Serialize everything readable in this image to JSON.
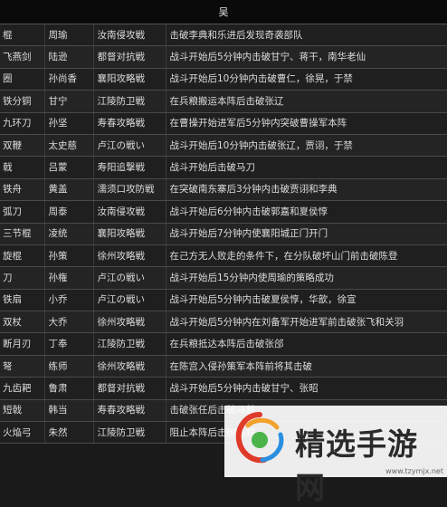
{
  "header": {
    "title": "吴"
  },
  "table": {
    "rows": [
      [
        "棍",
        "周瑜",
        "汝南侵攻戦",
        "击破李典和乐进后发现奇袭部队"
      ],
      [
        "飞燕剑",
        "陆逊",
        "都督对抗戦",
        "战斗开始后5分钟内击破甘宁、蒋干，南华老仙"
      ],
      [
        "圈",
        "孙尚香",
        "襄阳攻略戦",
        "战斗开始后10分钟内击破曹仁，徐晃，于禁"
      ],
      [
        "铁分铜",
        "甘宁",
        "江陵防卫戦",
        "在兵粮搬运本阵后击破张辽"
      ],
      [
        "九环刀",
        "孙坚",
        "寿春攻略戦",
        "在曹操开始进军后5分钟内突破曹操军本阵"
      ],
      [
        "双鞭",
        "太史慈",
        "卢江の戦い",
        "战斗开始后10分钟内击破张辽，贾诩，于禁"
      ],
      [
        "戟",
        "吕蒙",
        "寿阳追撃戦",
        "战斗开始后击破马刀"
      ],
      [
        "铁舟",
        "黄盖",
        "濡须口攻防戦",
        "在突破南东寨后3分钟内击破贾诩和李典"
      ],
      [
        "弧刀",
        "周泰",
        "汝南侵攻戦",
        "战斗开始后6分钟内击破郭嘉和夏侯惇"
      ],
      [
        "三节棍",
        "凌统",
        "襄阳攻略戦",
        "战斗开始后7分钟内使襄阳城正门开门"
      ],
      [
        "旋棍",
        "孙策",
        "徐州攻略戦",
        "在己方无人败走的条件下，在分队破坏山门前击破陈登"
      ],
      [
        "刀",
        "孙権",
        "卢江の戦い",
        "战斗开始后15分钟内使周瑜的策略成功"
      ],
      [
        "铁扇",
        "小乔",
        "卢江の戦い",
        "战斗开始后5分钟内击破夏侯惇，华歆，徐宣"
      ],
      [
        "双杖",
        "大乔",
        "徐州攻略戦",
        "战斗开始后5分钟内在刘备军开始进军前击破张飞和关羽"
      ],
      [
        "断月刃",
        "丁奉",
        "江陵防卫戦",
        "在兵粮抵达本阵后击破张郃"
      ],
      [
        "弩",
        "练师",
        "徐州攻略戦",
        "在陈宫入侵孙策军本阵前将其击破"
      ],
      [
        "九齿耙",
        "鲁肃",
        "都督对抗戦",
        "战斗开始后5分钟内击破甘宁、张昭"
      ],
      [
        "短戟",
        "韩当",
        "寿春攻略戦",
        "击破张任后击破马超"
      ],
      [
        "火焔弓",
        "朱然",
        "江陵防卫戦",
        "阻止本阵后击破马超"
      ]
    ]
  },
  "watermark": {
    "text": "精选手游网",
    "url": "www.tzymjx.net"
  }
}
